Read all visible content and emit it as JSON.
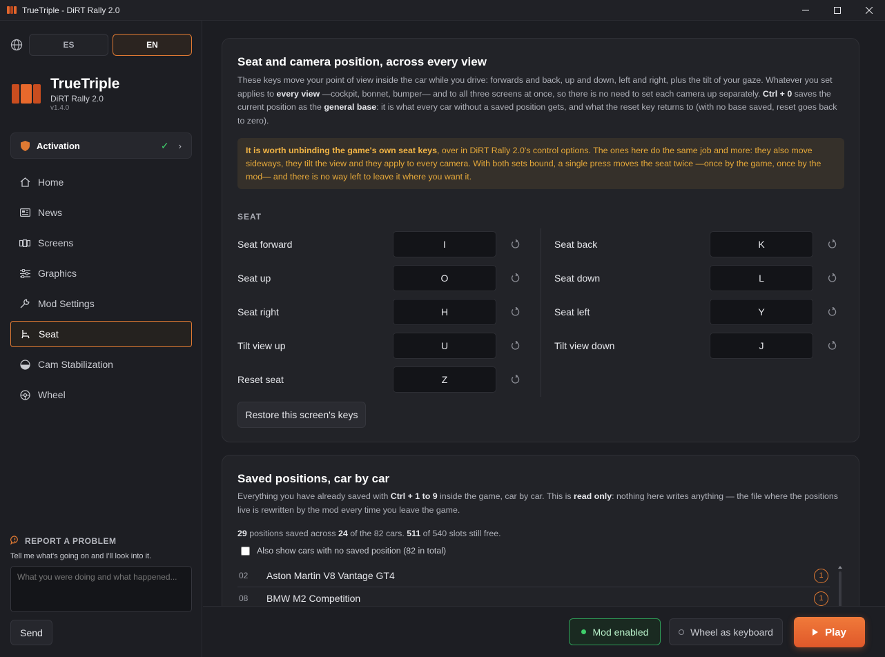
{
  "window": {
    "title": "TrueTriple - DiRT Rally 2.0",
    "minimize_icon": "minimize-icon",
    "maximize_icon": "maximize-icon",
    "close_icon": "close-icon"
  },
  "colors": {
    "accent": "#e07a33",
    "success": "#3fcf6b",
    "warning_text": "#e6a93a",
    "background": "#1c1d22"
  },
  "sidebar": {
    "languages": [
      {
        "label": "ES",
        "active": false
      },
      {
        "label": "EN",
        "active": true
      }
    ],
    "brand": {
      "name": "TrueTriple",
      "game": "DiRT Rally 2.0",
      "version": "v1.4.0"
    },
    "activation": {
      "label": "Activation",
      "status": "✓",
      "chevron": "›"
    },
    "nav": [
      {
        "label": "Home",
        "icon": "home-icon"
      },
      {
        "label": "News",
        "icon": "news-icon"
      },
      {
        "label": "Screens",
        "icon": "screens-icon"
      },
      {
        "label": "Graphics",
        "icon": "sliders-icon"
      },
      {
        "label": "Mod Settings",
        "icon": "wrench-icon"
      },
      {
        "label": "Seat",
        "icon": "seat-icon",
        "active": true
      },
      {
        "label": "Cam Stabilization",
        "icon": "half-circle-icon"
      },
      {
        "label": "Wheel",
        "icon": "steering-wheel-icon"
      }
    ],
    "report": {
      "title": "REPORT A PROBLEM",
      "description": "Tell me what's going on and I'll look into it.",
      "placeholder": "What you were doing and what happened...",
      "send_label": "Send"
    }
  },
  "seat_card": {
    "title": "Seat and camera position, across every view",
    "desc_parts": [
      "These keys move your point of view inside the car while you drive: forwards and back, up and down, left and right, plus the tilt of your gaze. Whatever you set applies to ",
      "every view",
      " —cockpit, bonnet, bumper— and to all three screens at once, so there is no need to set each camera up separately. ",
      "Ctrl + 0",
      " saves the current position as the ",
      "general base",
      ": it is what every car without a saved position gets, and what the reset key returns to (with no base saved, reset goes back to zero)."
    ],
    "warning_bold": "It is worth unbinding the game's own seat keys",
    "warning_text": ", over in DiRT Rally 2.0's control options. The ones here do the same job and more: they also move sideways, they tilt the view and they apply to every camera. With both sets bound, a single press moves the seat twice —once by the game, once by the mod— and there is no way left to leave it where you want it.",
    "section_label": "SEAT",
    "left_keys": [
      {
        "label": "Seat forward",
        "key": "I"
      },
      {
        "label": "Seat up",
        "key": "O"
      },
      {
        "label": "Seat right",
        "key": "H"
      },
      {
        "label": "Tilt view up",
        "key": "U"
      },
      {
        "label": "Reset seat",
        "key": "Z"
      }
    ],
    "right_keys": [
      {
        "label": "Seat back",
        "key": "K"
      },
      {
        "label": "Seat down",
        "key": "L"
      },
      {
        "label": "Seat left",
        "key": "Y"
      },
      {
        "label": "Tilt view down",
        "key": "J"
      }
    ],
    "restore_label": "Restore this screen's keys"
  },
  "saved_card": {
    "title": "Saved positions, car by car",
    "desc_parts": [
      "Everything you have already saved with ",
      "Ctrl + 1 to 9",
      " inside the game, car by car. This is ",
      "read only",
      ": nothing here writes anything — the file where the positions live is rewritten by the mod every time you leave the game."
    ],
    "stats": {
      "saved": "29",
      "text1": " positions saved across ",
      "cars_with": "24",
      "text2": " of the 82 cars. ",
      "free": "511",
      "text3": " of 540 slots still free."
    },
    "show_all_label": "Also show cars with no saved position (82 in total)",
    "show_all_checked": false,
    "cars": [
      {
        "num": "02",
        "name": "Aston Martin V8 Vantage GT4",
        "count": "1"
      },
      {
        "num": "08",
        "name": "BMW M2 Competition",
        "count": "1"
      }
    ]
  },
  "bottom": {
    "mod_status": "Mod enabled",
    "wheel_keyboard": "Wheel as keyboard",
    "play": "Play"
  }
}
